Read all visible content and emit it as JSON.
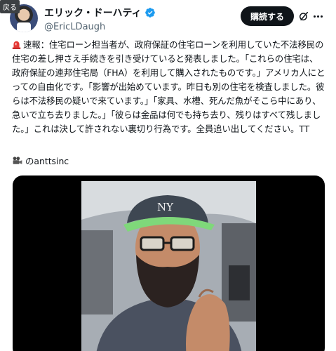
{
  "tooltip": "戻る",
  "author": {
    "display_name": "エリック・ドーハティ",
    "handle": "@EricLDaugh",
    "avatar_icon": "avatar-photo",
    "verified_icon": "verified-badge-icon",
    "verified_color": "#1d9bf0"
  },
  "actions": {
    "subscribe_label": "購読する",
    "grok_icon": "grok-icon",
    "more_icon": "more-icon"
  },
  "tweet": {
    "siren_icon": "siren-emoji",
    "text": "速報：住宅ローン担当者が、政府保証の住宅ローンを利用していた不法移民の住宅の差し押さえ手続きを引き受けていると発表しました。「これらの住宅は、政府保証の連邦住宅局（FHA）を利用して購入されたものです。」アメリカ人にとっての自由化です。「影響が出始めています。昨日も別の住宅を検査しました。彼らは不法移民の疑いで来ています。」「家具、水槽、死んだ魚がそこら中にあり、急いで立ち去りました。」「彼らは金品は何でも持ち去り、残りはすべて残しました。」これは決して許されない裏切り行為です。全員追い出してください。TT",
    "credit_icon": "movie-camera-emoji",
    "credit": "のanttsinc"
  },
  "media": {
    "type": "video",
    "subject": "man with cap and glasses in car",
    "cap_logo": "NY"
  }
}
